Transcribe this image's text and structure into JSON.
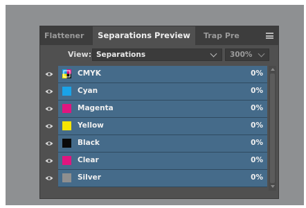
{
  "tabs": [
    {
      "label": "Flattener",
      "active": false
    },
    {
      "label": "Separations Preview",
      "active": true
    },
    {
      "label": "Trap Pre",
      "active": false
    }
  ],
  "panel_menu_icon": "hamburger-menu-icon",
  "view": {
    "label": "View:",
    "value": "Separations",
    "zoom": "300%"
  },
  "inks": [
    {
      "name": "CMYK",
      "percent": "0%",
      "color": "#000000",
      "multicolor": true
    },
    {
      "name": "Cyan",
      "percent": "0%",
      "color": "#1aa3e8"
    },
    {
      "name": "Magenta",
      "percent": "0%",
      "color": "#e0157f"
    },
    {
      "name": "Yellow",
      "percent": "0%",
      "color": "#f6e500"
    },
    {
      "name": "Black",
      "percent": "0%",
      "color": "#0a0a0a"
    },
    {
      "name": "Clear",
      "percent": "0%",
      "color": "#e0157f"
    },
    {
      "name": "Silver",
      "percent": "0%",
      "color": "#8f8f8f"
    }
  ],
  "colors": {
    "row_highlight": "#456b8a",
    "panel_bg": "#505050",
    "tab_bg": "#3d3d3d"
  }
}
